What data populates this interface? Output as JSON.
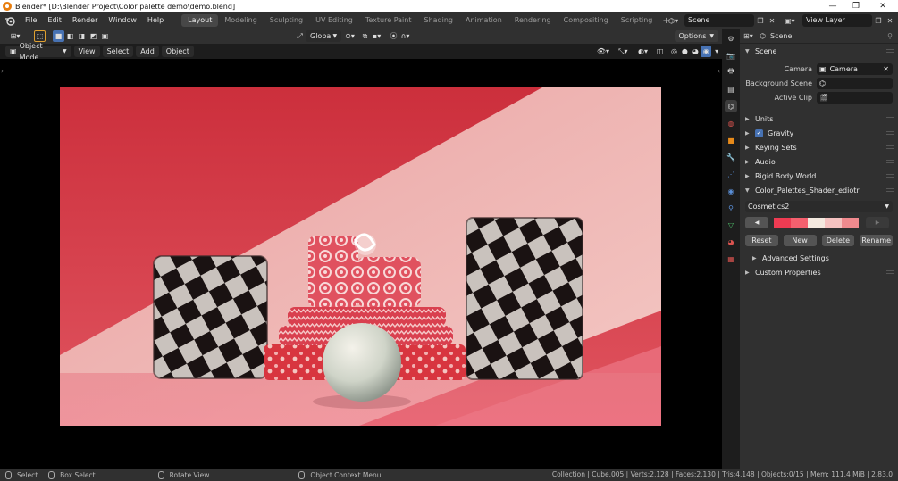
{
  "window": {
    "title": "Blender* [D:\\Blender Project\\Color palette demo\\demo.blend]",
    "controls": [
      "—",
      "❐",
      "✕"
    ]
  },
  "topbar": {
    "menus": [
      "File",
      "Edit",
      "Render",
      "Window",
      "Help"
    ],
    "workspaces": [
      "Layout",
      "Modeling",
      "Sculpting",
      "UV Editing",
      "Texture Paint",
      "Shading",
      "Animation",
      "Rendering",
      "Compositing",
      "Scripting"
    ],
    "active_workspace": "Layout",
    "add_workspace": "+",
    "scene_name": "Scene",
    "view_layer": "View Layer"
  },
  "viewport_header": {
    "orientation": "Global",
    "options": "Options",
    "mode": "Object Mode",
    "menus": [
      "View",
      "Select",
      "Add",
      "Object"
    ]
  },
  "statusbar": {
    "hints": [
      "Select",
      "Box Select",
      "Rotate View",
      "Object Context Menu"
    ],
    "stats": "Collection | Cube.005 | Verts:2,128 | Faces:2,130 | Tris:4,148 | Objects:0/15 | Mem: 111.4 MiB | 2.83.0"
  },
  "properties": {
    "context": "Scene",
    "panel_scene": {
      "title": "Scene",
      "camera_label": "Camera",
      "camera_value": "Camera",
      "background_scene_label": "Background Scene",
      "active_clip_label": "Active Clip"
    },
    "panels": [
      "Units",
      "Gravity",
      "Keying Sets",
      "Audio",
      "Rigid Body World"
    ],
    "gravity_checked": true,
    "color_palette": {
      "title": "Color_Palettes_Shader_ediotr",
      "selected_palette": "Cosmetics2",
      "swatches": [
        "#ee3b52",
        "#f4606e",
        "#f4e9df",
        "#f5c2c0",
        "#f08a8e"
      ],
      "buttons": [
        "Reset",
        "New",
        "Delete",
        "Rename"
      ],
      "advanced": "Advanced Settings"
    },
    "custom_properties": "Custom Properties"
  },
  "colors": {
    "accent_blue": "#4772b3",
    "background_red": "#d8343f",
    "header_bg": "#303030"
  }
}
